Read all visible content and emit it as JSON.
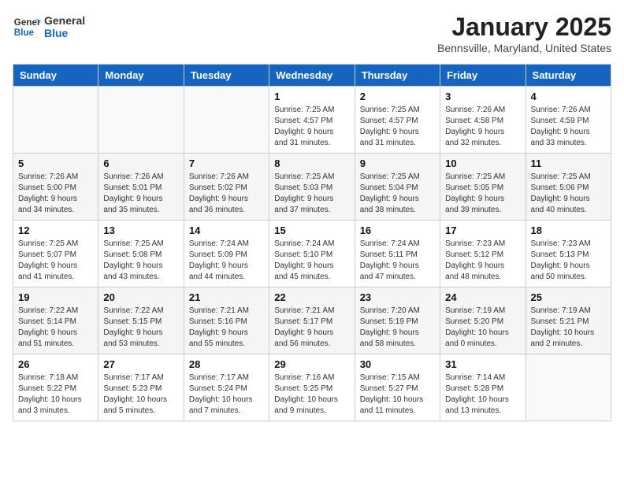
{
  "header": {
    "logo_general": "General",
    "logo_blue": "Blue",
    "title": "January 2025",
    "subtitle": "Bennsville, Maryland, United States"
  },
  "weekdays": [
    "Sunday",
    "Monday",
    "Tuesday",
    "Wednesday",
    "Thursday",
    "Friday",
    "Saturday"
  ],
  "weeks": [
    [
      {
        "day": "",
        "info": ""
      },
      {
        "day": "",
        "info": ""
      },
      {
        "day": "",
        "info": ""
      },
      {
        "day": "1",
        "info": "Sunrise: 7:25 AM\nSunset: 4:57 PM\nDaylight: 9 hours\nand 31 minutes."
      },
      {
        "day": "2",
        "info": "Sunrise: 7:25 AM\nSunset: 4:57 PM\nDaylight: 9 hours\nand 31 minutes."
      },
      {
        "day": "3",
        "info": "Sunrise: 7:26 AM\nSunset: 4:58 PM\nDaylight: 9 hours\nand 32 minutes."
      },
      {
        "day": "4",
        "info": "Sunrise: 7:26 AM\nSunset: 4:59 PM\nDaylight: 9 hours\nand 33 minutes."
      }
    ],
    [
      {
        "day": "5",
        "info": "Sunrise: 7:26 AM\nSunset: 5:00 PM\nDaylight: 9 hours\nand 34 minutes."
      },
      {
        "day": "6",
        "info": "Sunrise: 7:26 AM\nSunset: 5:01 PM\nDaylight: 9 hours\nand 35 minutes."
      },
      {
        "day": "7",
        "info": "Sunrise: 7:26 AM\nSunset: 5:02 PM\nDaylight: 9 hours\nand 36 minutes."
      },
      {
        "day": "8",
        "info": "Sunrise: 7:25 AM\nSunset: 5:03 PM\nDaylight: 9 hours\nand 37 minutes."
      },
      {
        "day": "9",
        "info": "Sunrise: 7:25 AM\nSunset: 5:04 PM\nDaylight: 9 hours\nand 38 minutes."
      },
      {
        "day": "10",
        "info": "Sunrise: 7:25 AM\nSunset: 5:05 PM\nDaylight: 9 hours\nand 39 minutes."
      },
      {
        "day": "11",
        "info": "Sunrise: 7:25 AM\nSunset: 5:06 PM\nDaylight: 9 hours\nand 40 minutes."
      }
    ],
    [
      {
        "day": "12",
        "info": "Sunrise: 7:25 AM\nSunset: 5:07 PM\nDaylight: 9 hours\nand 41 minutes."
      },
      {
        "day": "13",
        "info": "Sunrise: 7:25 AM\nSunset: 5:08 PM\nDaylight: 9 hours\nand 43 minutes."
      },
      {
        "day": "14",
        "info": "Sunrise: 7:24 AM\nSunset: 5:09 PM\nDaylight: 9 hours\nand 44 minutes."
      },
      {
        "day": "15",
        "info": "Sunrise: 7:24 AM\nSunset: 5:10 PM\nDaylight: 9 hours\nand 45 minutes."
      },
      {
        "day": "16",
        "info": "Sunrise: 7:24 AM\nSunset: 5:11 PM\nDaylight: 9 hours\nand 47 minutes."
      },
      {
        "day": "17",
        "info": "Sunrise: 7:23 AM\nSunset: 5:12 PM\nDaylight: 9 hours\nand 48 minutes."
      },
      {
        "day": "18",
        "info": "Sunrise: 7:23 AM\nSunset: 5:13 PM\nDaylight: 9 hours\nand 50 minutes."
      }
    ],
    [
      {
        "day": "19",
        "info": "Sunrise: 7:22 AM\nSunset: 5:14 PM\nDaylight: 9 hours\nand 51 minutes."
      },
      {
        "day": "20",
        "info": "Sunrise: 7:22 AM\nSunset: 5:15 PM\nDaylight: 9 hours\nand 53 minutes."
      },
      {
        "day": "21",
        "info": "Sunrise: 7:21 AM\nSunset: 5:16 PM\nDaylight: 9 hours\nand 55 minutes."
      },
      {
        "day": "22",
        "info": "Sunrise: 7:21 AM\nSunset: 5:17 PM\nDaylight: 9 hours\nand 56 minutes."
      },
      {
        "day": "23",
        "info": "Sunrise: 7:20 AM\nSunset: 5:19 PM\nDaylight: 9 hours\nand 58 minutes."
      },
      {
        "day": "24",
        "info": "Sunrise: 7:19 AM\nSunset: 5:20 PM\nDaylight: 10 hours\nand 0 minutes."
      },
      {
        "day": "25",
        "info": "Sunrise: 7:19 AM\nSunset: 5:21 PM\nDaylight: 10 hours\nand 2 minutes."
      }
    ],
    [
      {
        "day": "26",
        "info": "Sunrise: 7:18 AM\nSunset: 5:22 PM\nDaylight: 10 hours\nand 3 minutes."
      },
      {
        "day": "27",
        "info": "Sunrise: 7:17 AM\nSunset: 5:23 PM\nDaylight: 10 hours\nand 5 minutes."
      },
      {
        "day": "28",
        "info": "Sunrise: 7:17 AM\nSunset: 5:24 PM\nDaylight: 10 hours\nand 7 minutes."
      },
      {
        "day": "29",
        "info": "Sunrise: 7:16 AM\nSunset: 5:25 PM\nDaylight: 10 hours\nand 9 minutes."
      },
      {
        "day": "30",
        "info": "Sunrise: 7:15 AM\nSunset: 5:27 PM\nDaylight: 10 hours\nand 11 minutes."
      },
      {
        "day": "31",
        "info": "Sunrise: 7:14 AM\nSunset: 5:28 PM\nDaylight: 10 hours\nand 13 minutes."
      },
      {
        "day": "",
        "info": ""
      }
    ]
  ]
}
